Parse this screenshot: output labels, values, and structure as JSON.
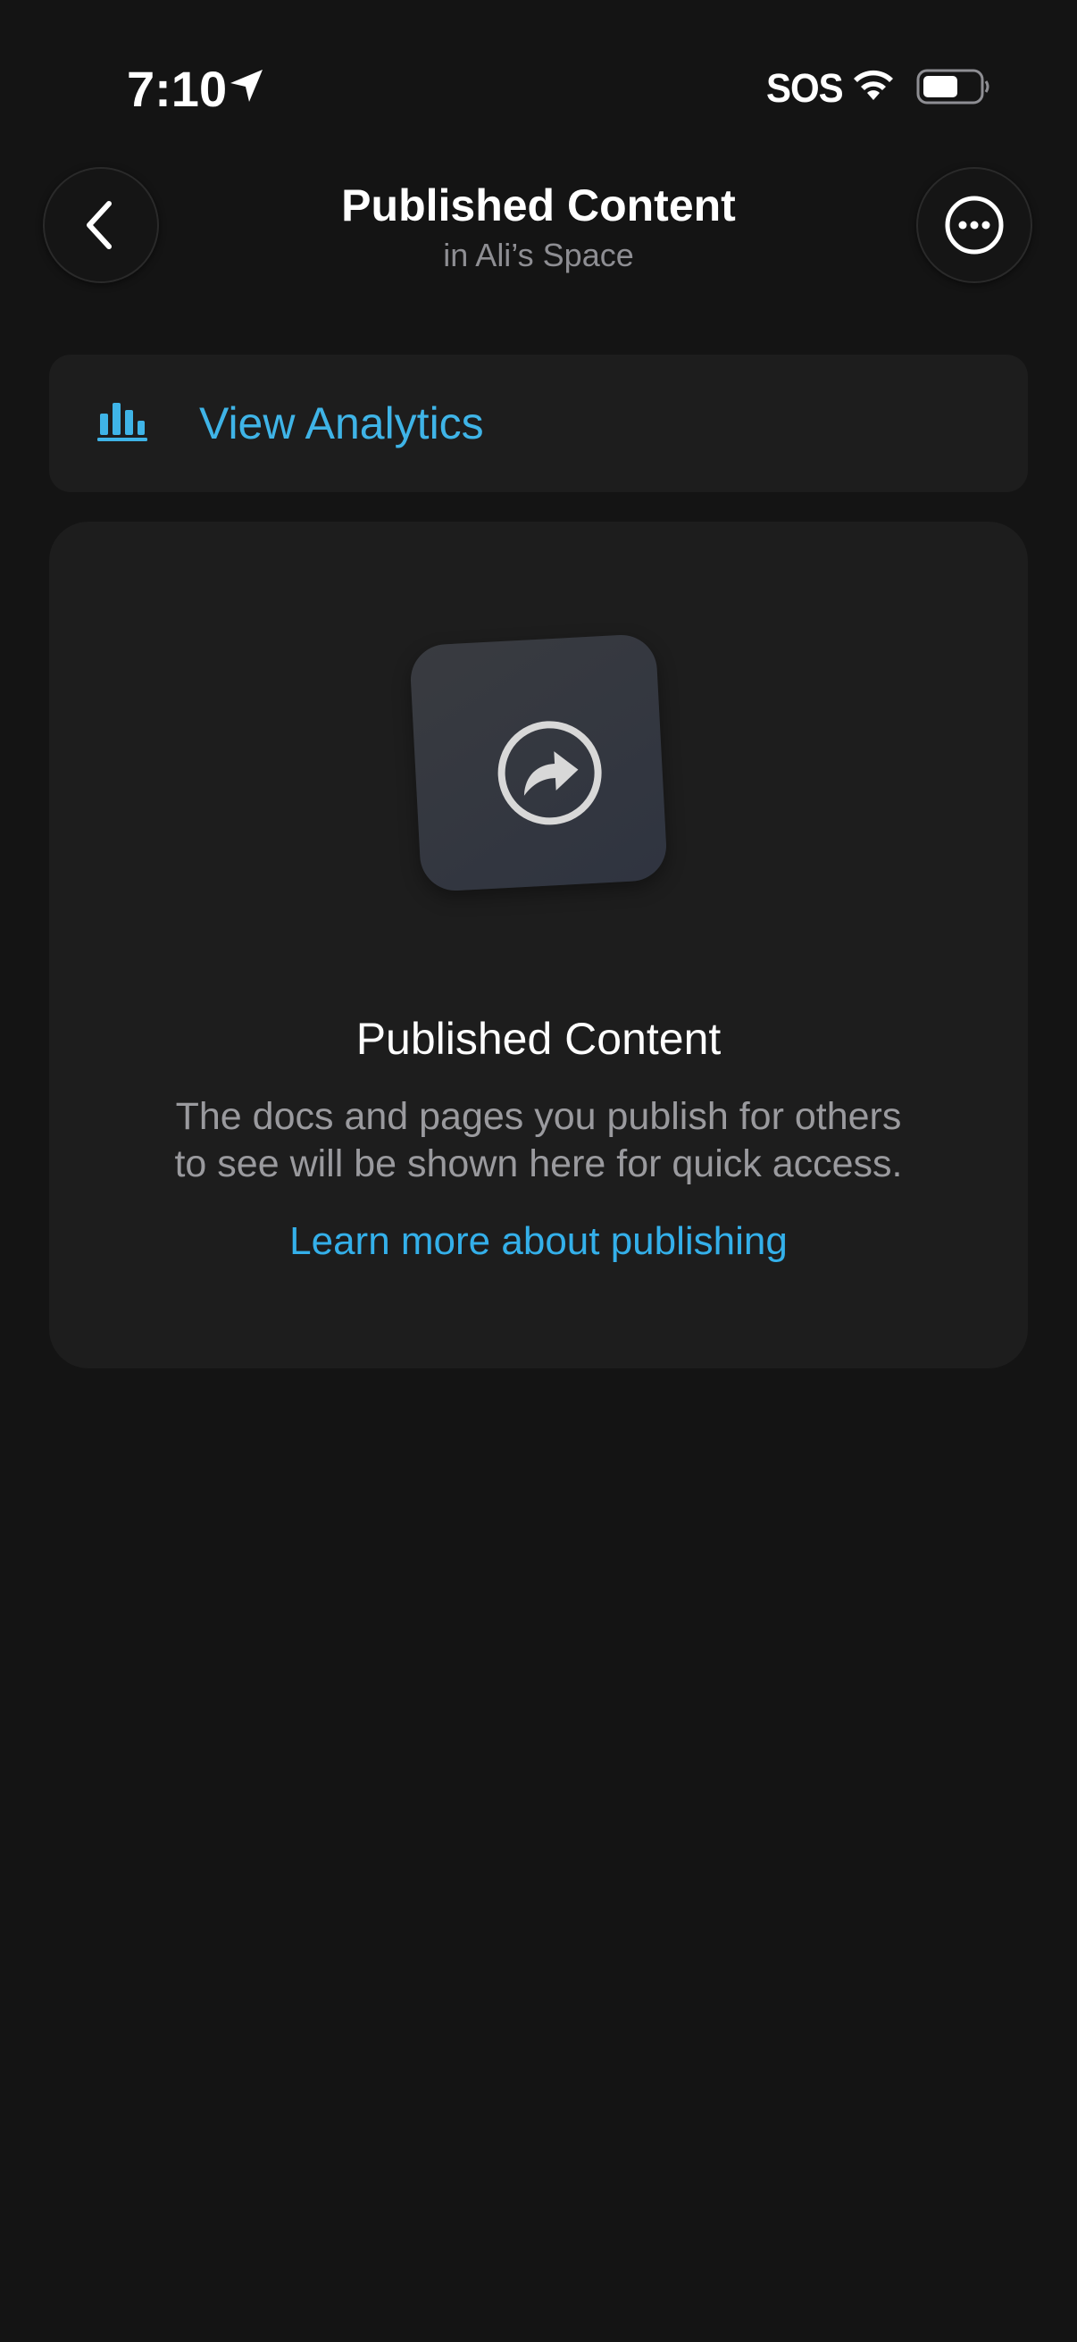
{
  "status_bar": {
    "time": "7:10",
    "sos": "SOS",
    "icons": [
      "location-arrow-icon",
      "wifi-icon",
      "battery-icon"
    ]
  },
  "header": {
    "title": "Published Content",
    "subtitle": "in Ali’s Space",
    "back_icon": "chevron-left-icon",
    "more_icon": "ellipsis-circle-icon"
  },
  "analytics": {
    "label": "View Analytics",
    "icon": "bar-chart-icon"
  },
  "empty_state": {
    "icon": "share-arrow-icon",
    "title": "Published Content",
    "description_line1": "The docs and pages you publish for others",
    "description_line2": "to see will be shown here for quick access.",
    "link": "Learn more about publishing"
  },
  "colors": {
    "background": "#141414",
    "card": "#1d1d1d",
    "accent": "#3fb4e7",
    "secondary_text": "#9a9a9e"
  }
}
